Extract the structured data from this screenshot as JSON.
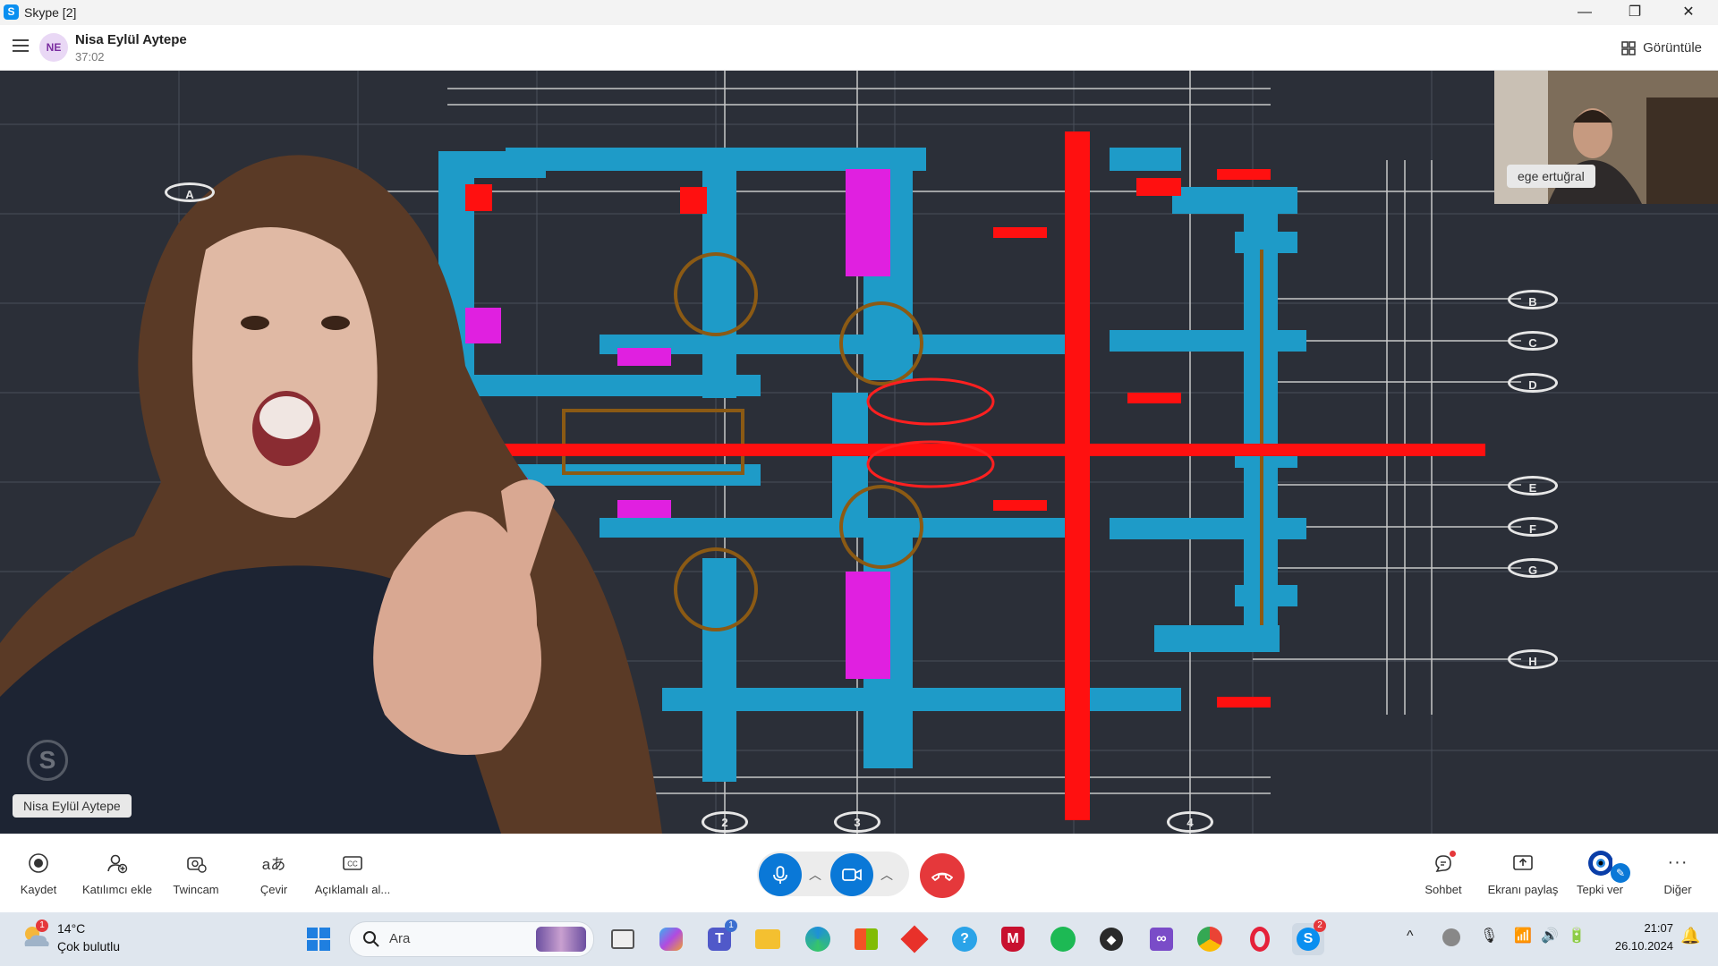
{
  "window": {
    "title": "Skype [2]",
    "minimize": "—",
    "maximize": "❐",
    "close": "✕"
  },
  "call": {
    "contact_initials": "NE",
    "contact_name": "Nisa Eylül Aytepe",
    "duration": "37:02",
    "view_label": "Görüntüle"
  },
  "stage": {
    "main_participant": "Nisa Eylül Aytepe",
    "self_participant": "ege ertuğral",
    "grid_row_labels": [
      "A",
      "B",
      "C",
      "D",
      "E",
      "F",
      "G",
      "H"
    ],
    "grid_col_labels": [
      "2",
      "3",
      "4"
    ]
  },
  "controls": {
    "left": [
      {
        "label": "Kaydet",
        "icon": "record-icon"
      },
      {
        "label": "Katılımcı ekle",
        "icon": "add-participant-icon"
      },
      {
        "label": "Twincam",
        "icon": "twincam-icon"
      },
      {
        "label": "Çevir",
        "icon": "translate-icon"
      },
      {
        "label": "Açıklamalı al...",
        "icon": "captions-icon"
      }
    ],
    "right": [
      {
        "label": "Sohbet",
        "icon": "chat-icon"
      },
      {
        "label": "Ekranı paylaş",
        "icon": "share-screen-icon"
      },
      {
        "label": "Tepki ver",
        "icon": "reaction-icon"
      },
      {
        "label": "Diğer",
        "icon": "more-icon"
      }
    ],
    "colors": {
      "accent": "#0a78d7",
      "hangup": "#e5383b"
    }
  },
  "taskbar": {
    "weather_temp": "14°C",
    "weather_desc": "Çok bulutlu",
    "weather_badge": "1",
    "search_placeholder": "Ara",
    "teams_badge": "1",
    "skype_badge": "2",
    "time": "21:07",
    "date": "26.10.2024"
  }
}
